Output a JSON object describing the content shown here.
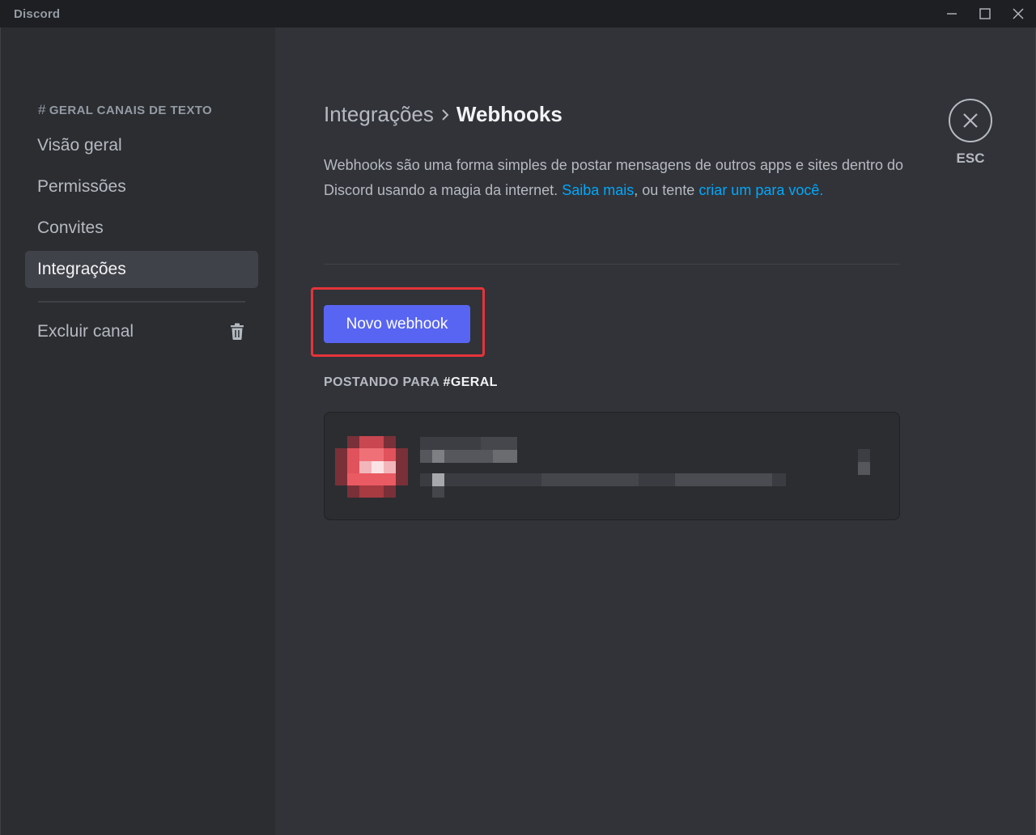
{
  "window": {
    "app_name": "Discord",
    "controls": [
      "minimize-icon",
      "maximize-icon",
      "close-icon"
    ]
  },
  "sidebar": {
    "header_hash": "#",
    "header_channel": "GERAL",
    "header_section": "CANAIS DE TEXTO",
    "items": [
      {
        "label": "Visão geral",
        "active": false
      },
      {
        "label": "Permissões",
        "active": false
      },
      {
        "label": "Convites",
        "active": false
      },
      {
        "label": "Integrações",
        "active": true
      }
    ],
    "delete_label": "Excluir canal",
    "delete_icon": "trash-icon"
  },
  "main": {
    "breadcrumb_parent": "Integrações",
    "breadcrumb_current": "Webhooks",
    "description_text": "Webhooks são uma forma simples de postar mensagens de outros apps e sites dentro do Discord usando a magia da internet.",
    "learn_more_link": "Saiba mais",
    "description_middle": ", ou tente",
    "create_link": "criar um para você.",
    "new_webhook_button": "Novo webhook",
    "posting_to_label": "POSTANDO PARA",
    "posting_to_channel": "#GERAL"
  },
  "close": {
    "icon": "close-icon",
    "label": "ESC"
  },
  "colors": {
    "accent": "#5865f2",
    "link": "#00a8fc",
    "highlight": "#e5343a",
    "background": "#313338",
    "sidebar": "#2b2d31"
  }
}
